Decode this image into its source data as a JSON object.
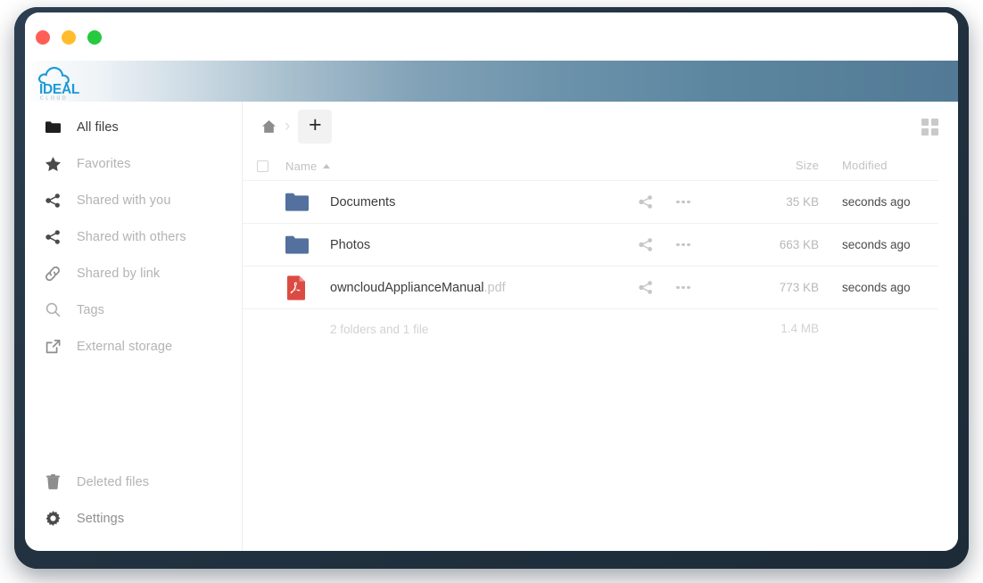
{
  "window": {
    "traffic_lights": [
      {
        "name": "close",
        "color": "#ff5f56"
      },
      {
        "name": "minimize",
        "color": "#ffbd2e"
      },
      {
        "name": "maximize",
        "color": "#27c93f"
      }
    ]
  },
  "brand": {
    "name": "IDEAL",
    "subtitle": "CLOUD",
    "accent": "#1c9ad6",
    "header_gradient_from": "#fdfefe",
    "header_gradient_to": "#527a96"
  },
  "sidebar": {
    "items": [
      {
        "label": "All files",
        "icon": "folder-icon",
        "active": true
      },
      {
        "label": "Favorites",
        "icon": "star-icon",
        "active": false
      },
      {
        "label": "Shared with you",
        "icon": "share-icon",
        "active": false
      },
      {
        "label": "Shared with others",
        "icon": "share-icon",
        "active": false
      },
      {
        "label": "Shared by link",
        "icon": "link-icon",
        "active": false
      },
      {
        "label": "Tags",
        "icon": "search-icon",
        "active": false
      },
      {
        "label": "External storage",
        "icon": "external-link-icon",
        "active": false
      }
    ],
    "bottom_items": [
      {
        "label": "Deleted files",
        "icon": "trash-icon"
      },
      {
        "label": "Settings",
        "icon": "gear-icon"
      }
    ]
  },
  "toolbar": {
    "home_icon": "home-icon",
    "separator": "›",
    "new_button_label": "+",
    "grid_view_icon": "grid-view-icon"
  },
  "table": {
    "columns": {
      "name": "Name",
      "size": "Size",
      "modified": "Modified"
    },
    "sort": {
      "column": "Name",
      "direction": "asc"
    },
    "select_all_checked": false,
    "rows": [
      {
        "icon": "folder-icon",
        "type": "folder",
        "name": "Documents",
        "ext": "",
        "size": "35 KB",
        "modified": "seconds ago"
      },
      {
        "icon": "folder-icon",
        "type": "folder",
        "name": "Photos",
        "ext": "",
        "size": "663 KB",
        "modified": "seconds ago"
      },
      {
        "icon": "pdf-icon",
        "type": "pdf",
        "name": "owncloudApplianceManual",
        "ext": ".pdf",
        "size": "773 KB",
        "modified": "seconds ago"
      }
    ],
    "summary": {
      "text": "2 folders and 1 file",
      "size": "1.4 MB"
    },
    "row_actions": {
      "share_icon": "share-icon",
      "more_icon": "more-options-icon"
    }
  },
  "colors": {
    "folder": "#53709e",
    "pdf": "#dc4b43",
    "bezel": "#22313f"
  }
}
